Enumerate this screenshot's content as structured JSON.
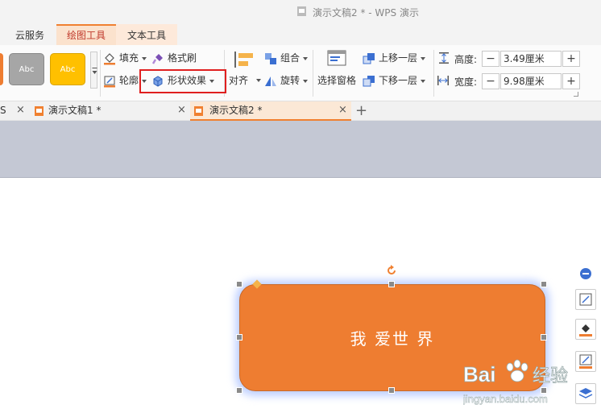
{
  "window": {
    "title": "演示文稿2 * - WPS 演示"
  },
  "ribbon_tabs": [
    {
      "label": "云服务",
      "active": false
    },
    {
      "label": "绘图工具",
      "active": true
    },
    {
      "label": "文本工具",
      "active": false
    }
  ],
  "ribbon": {
    "styles": [
      {
        "label": "",
        "color": "#ee7d31"
      },
      {
        "label": "Abc",
        "color": "#a6a6a6"
      },
      {
        "label": "Abc",
        "color": "#ffc000"
      }
    ],
    "fill_label": "填充",
    "format_painter_label": "格式刷",
    "outline_label": "轮廓",
    "shape_effects_label": "形状效果",
    "align_label": "对齐",
    "group_label": "组合",
    "rotate_label": "旋转",
    "selection_pane_label": "选择窗格",
    "bring_forward_label": "上移一层",
    "send_backward_label": "下移一层",
    "height_label": "高度:",
    "height_value": "3.49厘米",
    "width_label": "宽度:",
    "width_value": "9.98厘米",
    "minus": "−",
    "plus": "+"
  },
  "doc_tabs": [
    {
      "label": "S",
      "active": false
    },
    {
      "label": "演示文稿1 *",
      "active": false
    },
    {
      "label": "演示文稿2 *",
      "active": true
    }
  ],
  "doc_tab_close": "×",
  "doc_tab_add": "+",
  "shape": {
    "text": "我 爱世  界",
    "fill": "#ee7d31",
    "glow": "#9fb8ff"
  },
  "watermark": {
    "brand": "Bai",
    "brand_cn": "经验",
    "url": "jingyan.baidu.com"
  },
  "accent_color": "#f08030",
  "highlight_color": "#e02020"
}
